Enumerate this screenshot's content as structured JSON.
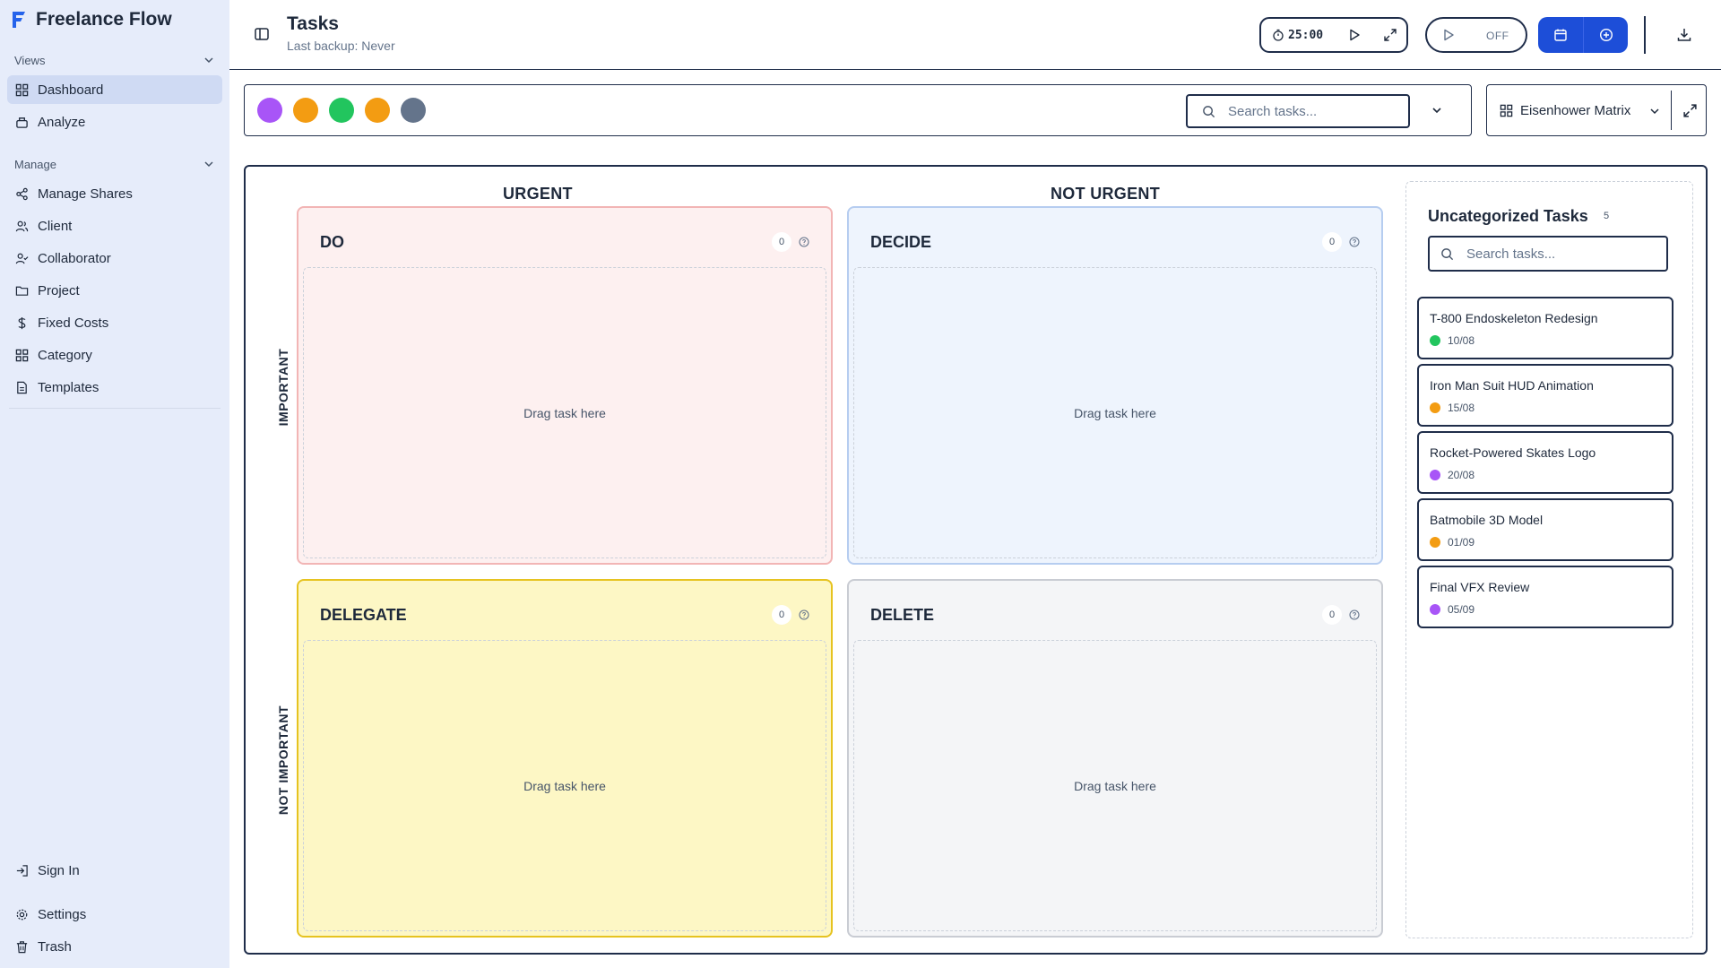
{
  "app": {
    "name": "Freelance Flow",
    "brand_color": "#2563eb"
  },
  "sidebar": {
    "views_label": "Views",
    "manage_label": "Manage",
    "views": [
      {
        "label": "Dashboard",
        "icon": "grid-icon",
        "active": true
      },
      {
        "label": "Analyze",
        "icon": "analyze-icon"
      }
    ],
    "manage": [
      {
        "label": "Manage Shares",
        "icon": "share-icon"
      },
      {
        "label": "Client",
        "icon": "users-icon"
      },
      {
        "label": "Collaborator",
        "icon": "user-check-icon"
      },
      {
        "label": "Project",
        "icon": "folder-icon"
      },
      {
        "label": "Fixed Costs",
        "icon": "dollar-icon"
      },
      {
        "label": "Category",
        "icon": "grid-icon"
      },
      {
        "label": "Templates",
        "icon": "file-icon"
      }
    ],
    "bottom": [
      {
        "label": "Sign In",
        "icon": "sign-in-icon"
      },
      {
        "label": "Settings",
        "icon": "gear-icon"
      },
      {
        "label": "Trash",
        "icon": "trash-icon"
      }
    ]
  },
  "header": {
    "title": "Tasks",
    "subtitle": "Last backup: Never",
    "timer": "25:00",
    "autoplay_state": "OFF",
    "accent_color": "#1d4ed8"
  },
  "toolbar": {
    "color_filters": [
      "#a855f7",
      "#f39c12",
      "#22c55e",
      "#f39c12",
      "#64748b"
    ],
    "search_placeholder": "Search tasks...",
    "view_mode": "Eisenhower Matrix"
  },
  "matrix": {
    "col_headers": [
      "URGENT",
      "NOT URGENT"
    ],
    "row_headers": [
      "IMPORTANT",
      "NOT IMPORTANT"
    ],
    "quadrants": [
      {
        "title": "DO",
        "count": "0",
        "placeholder": "Drag task here",
        "color": "#fdf0f0"
      },
      {
        "title": "DECIDE",
        "count": "0",
        "placeholder": "Drag task here",
        "color": "#eef4fd"
      },
      {
        "title": "DELEGATE",
        "count": "0",
        "placeholder": "Drag task here",
        "color": "#fdf7c5"
      },
      {
        "title": "DELETE",
        "count": "0",
        "placeholder": "Drag task here",
        "color": "#f4f5f7"
      }
    ]
  },
  "uncategorized": {
    "title": "Uncategorized Tasks",
    "count": "5",
    "search_placeholder": "Search tasks...",
    "tasks": [
      {
        "title": "T-800 Endoskeleton Redesign",
        "date": "10/08",
        "color": "#22c55e"
      },
      {
        "title": "Iron Man Suit HUD Animation",
        "date": "15/08",
        "color": "#f39c12"
      },
      {
        "title": "Rocket-Powered Skates Logo",
        "date": "20/08",
        "color": "#a855f7"
      },
      {
        "title": "Batmobile 3D Model",
        "date": "01/09",
        "color": "#f39c12"
      },
      {
        "title": "Final VFX Review",
        "date": "05/09",
        "color": "#a855f7"
      }
    ]
  }
}
